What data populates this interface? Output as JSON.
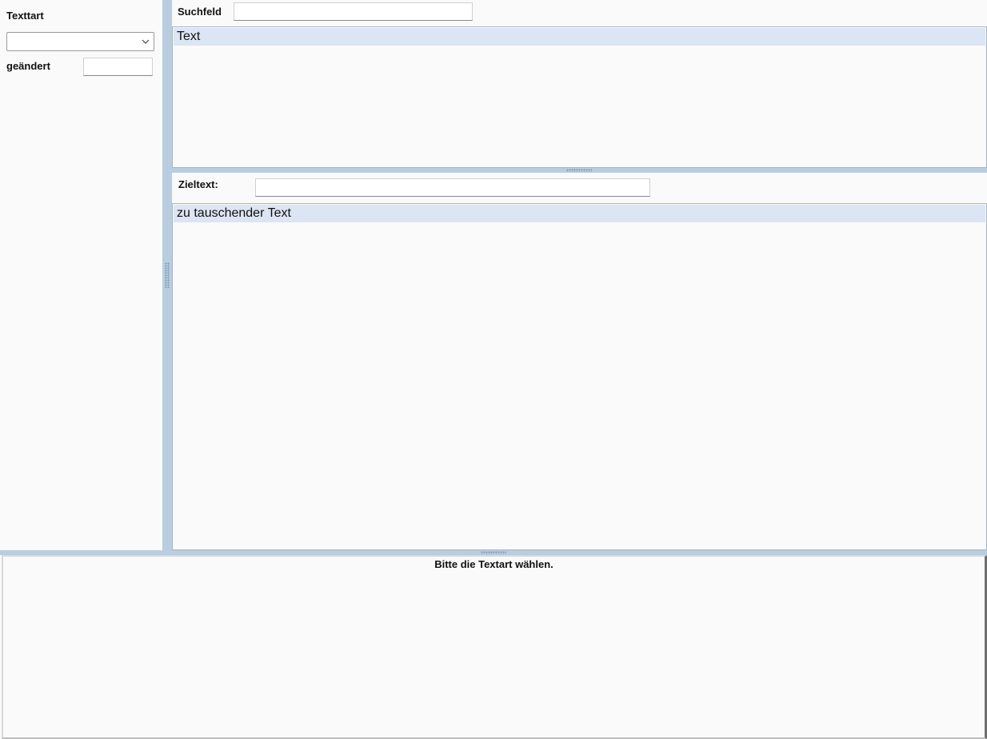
{
  "left": {
    "texttart_label": "Texttart",
    "texttart_select_value": "",
    "geaendert_label": "geändert",
    "geaendert_value": ""
  },
  "search": {
    "label": "Suchfeld",
    "value": ""
  },
  "grid_top": {
    "header": "Text"
  },
  "target": {
    "label": "Zieltext:",
    "value": ""
  },
  "grid_bottom": {
    "header": "zu tauschender Text"
  },
  "status": {
    "message": "Bitte die Textart wählen."
  },
  "colors": {
    "splitter": "#b8cde0",
    "grid_header": "#dbe5f3",
    "background": "#fafafa"
  },
  "icons": {
    "select_arrow": "chevron-down-icon",
    "splitter_grip": "grip-dots-icon"
  }
}
